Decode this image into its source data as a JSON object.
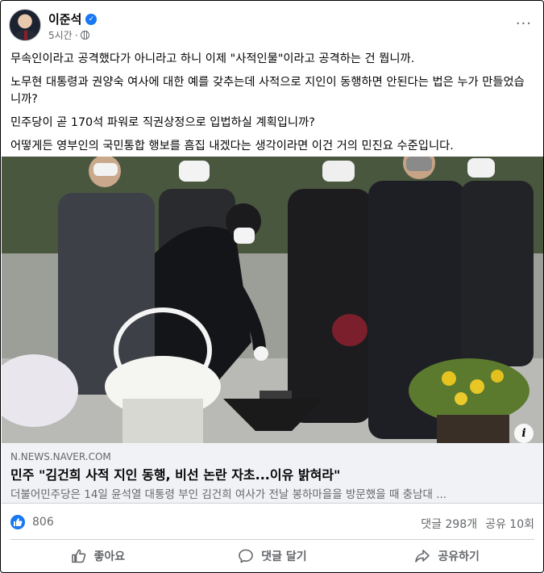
{
  "post": {
    "author": "이준석",
    "time": "5시간",
    "more_label": "···",
    "paragraphs": [
      "무속인이라고 공격했다가 아니라고 하니 이제 \"사적인물\"이라고 공격하는 건 뭡니까.",
      "노무현 대통령과 권양숙 여사에 대한 예를 갖추는데 사적으로 지인이 동행하면 안된다는 법은 누가 만들었습니까?",
      "민주당이 곧 170석 파워로 직권상정으로 입법하실 계획입니까?",
      "어떻게든 영부인의 국민통합 행보를 흠집 내겠다는 생각이라면 이건 거의 민진요 수준입니다."
    ]
  },
  "link": {
    "domain": "N.NEWS.NAVER.COM",
    "headline": "민주 \"김건희 사적 지인 동행, 비선 논란 자초...이유 밝혀라\"",
    "description": "더불어민주당은 14일 윤석열 대통령 부인 김건희 여사가 전날 봉하마을을 방문했을 때 충남대 ...",
    "info_label": "i"
  },
  "stats": {
    "likes": "806",
    "comments": "댓글 298개",
    "shares": "공유 10회"
  },
  "actions": {
    "like": "좋아요",
    "comment": "댓글 달기",
    "share": "공유하기"
  },
  "colors": {
    "accent": "#1877f2",
    "secondary_text": "#65676b",
    "link_bg": "#f0f2f5"
  }
}
